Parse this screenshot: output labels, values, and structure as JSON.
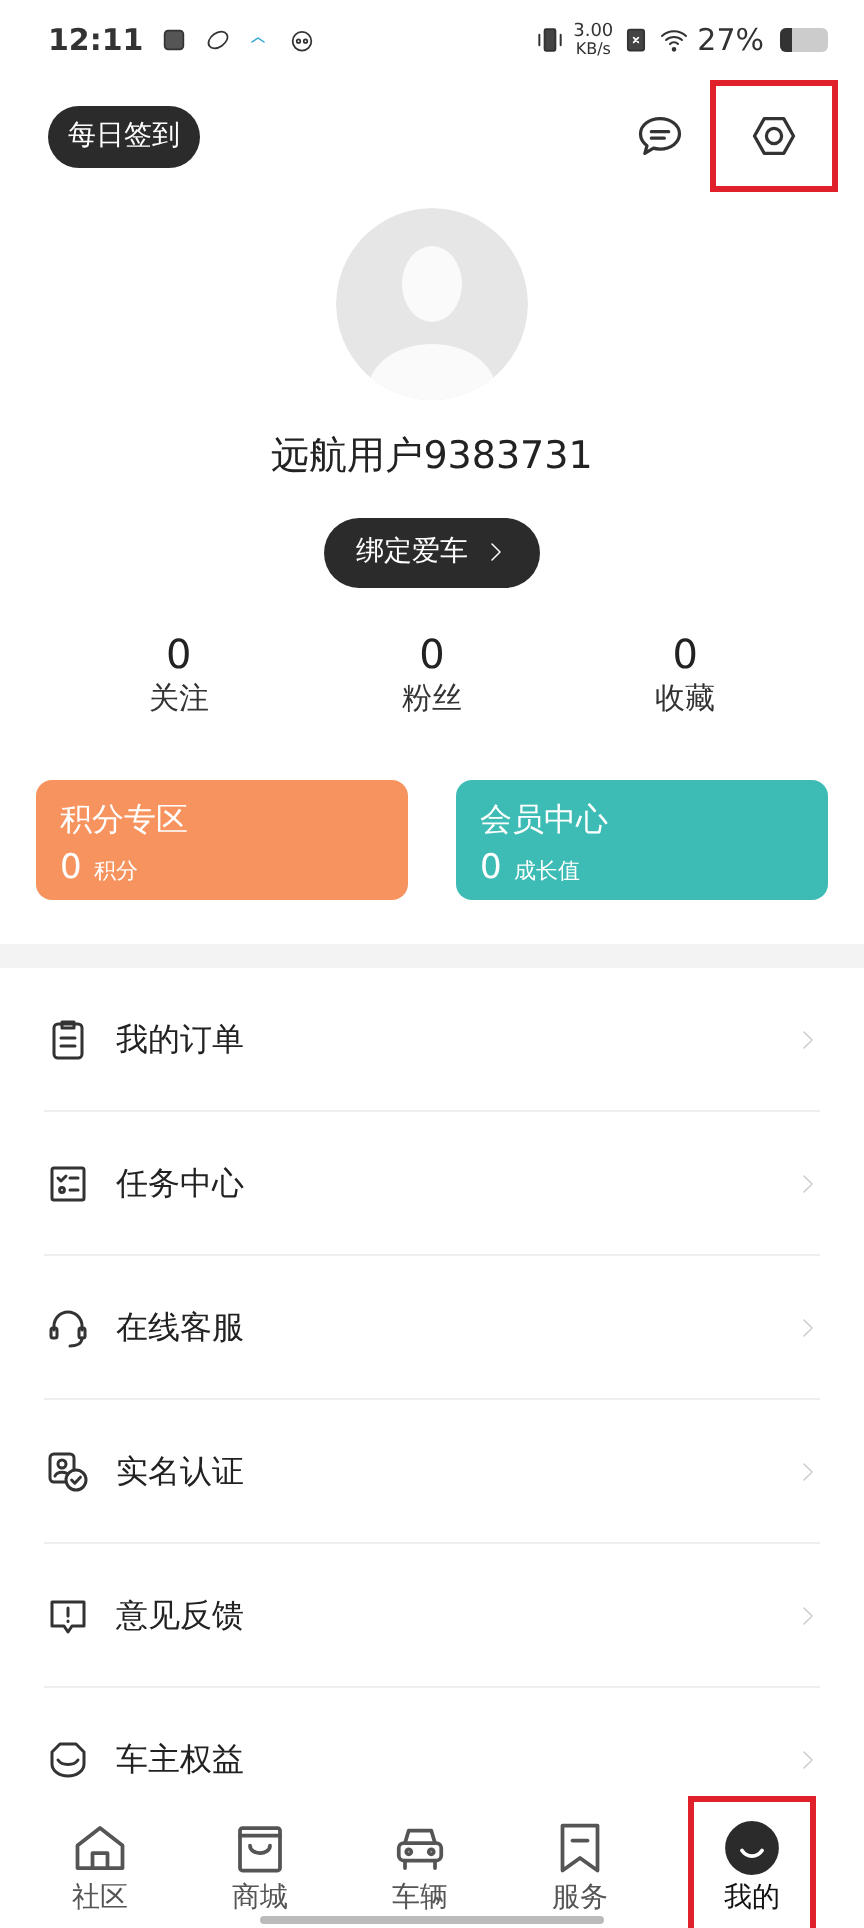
{
  "status_bar": {
    "time": "12:11",
    "speed": "3.00",
    "speed_unit": "KB/s",
    "battery": "27%"
  },
  "header": {
    "checkin_button": "每日签到",
    "settings_highlighted": true
  },
  "profile": {
    "username": "远航用户9383731",
    "bind_button": "绑定爱车"
  },
  "stats": [
    {
      "value": "0",
      "label": "关注"
    },
    {
      "value": "0",
      "label": "粉丝"
    },
    {
      "value": "0",
      "label": "收藏"
    }
  ],
  "cards": [
    {
      "title": "积分专区",
      "value": "0",
      "unit": "积分",
      "color": "#f7935f"
    },
    {
      "title": "会员中心",
      "value": "0",
      "unit": "成长值",
      "color": "#3dbcb5"
    }
  ],
  "menu": [
    {
      "label": "我的订单"
    },
    {
      "label": "任务中心"
    },
    {
      "label": "在线客服"
    },
    {
      "label": "实名认证"
    },
    {
      "label": "意见反馈"
    },
    {
      "label": "车主权益"
    }
  ],
  "tabs": [
    {
      "label": "社区",
      "selected": false,
      "highlighted": false
    },
    {
      "label": "商城",
      "selected": false,
      "highlighted": false
    },
    {
      "label": "车辆",
      "selected": false,
      "highlighted": false
    },
    {
      "label": "服务",
      "selected": false,
      "highlighted": false
    },
    {
      "label": "我的",
      "selected": true,
      "highlighted": true
    }
  ]
}
